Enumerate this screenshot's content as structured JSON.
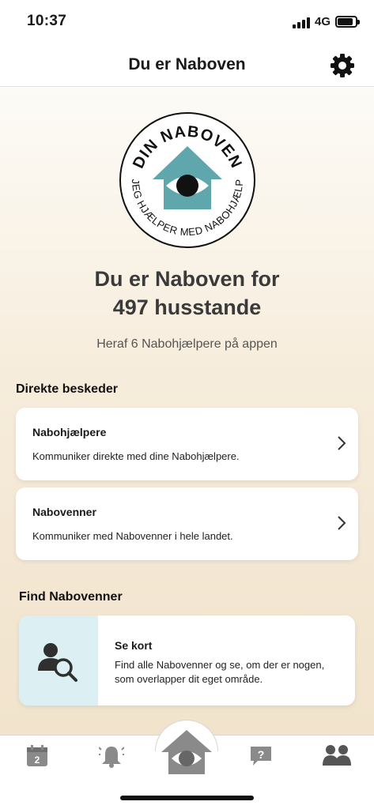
{
  "status_bar": {
    "time": "10:37",
    "network": "4G"
  },
  "nav": {
    "title": "Du er Naboven",
    "settings_icon": "gear-icon"
  },
  "logo": {
    "top_text": "DIN NABOVEN",
    "bottom_text": "JEG HJÆLPER MED NABOHJÆLP",
    "accent": "#5fa7ad"
  },
  "hero": {
    "line1": "Du er Naboven for",
    "line2": "497 husstande",
    "sub": "Heraf 6 Nabohjælpere på appen"
  },
  "direct_messages": {
    "title": "Direkte beskeder",
    "cards": [
      {
        "title": "Nabohjælpere",
        "text": "Kommuniker direkte med dine Nabohjælpere."
      },
      {
        "title": "Nabovenner",
        "text": "Kommuniker med Nabovenner i hele landet."
      }
    ]
  },
  "find": {
    "title": "Find Nabovenner",
    "card_title": "Se kort",
    "card_text": "Find alle Nabovenner og se, om der er nogen, som overlapper dit eget område.",
    "icon": "person-search-icon"
  },
  "tabs": [
    {
      "icon": "calendar-icon",
      "badge": "2"
    },
    {
      "icon": "bell-alert-icon"
    },
    {
      "icon": "house-eye-icon"
    },
    {
      "icon": "question-icon",
      "badge": "?"
    },
    {
      "icon": "people-icon"
    }
  ],
  "colors": {
    "tab_gray": "#8a8a8a",
    "text_dark": "#1a1a1a",
    "map_bg": "#dcf0f4"
  }
}
